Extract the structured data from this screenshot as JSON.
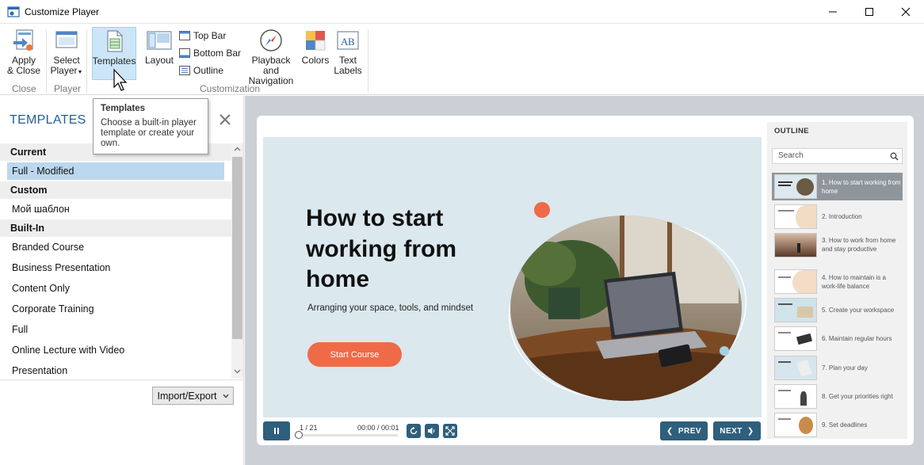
{
  "window": {
    "title": "Customize Player"
  },
  "ribbon": {
    "apply_close_line1": "Apply",
    "apply_close_line2": "& Close",
    "select_player_line1": "Select",
    "select_player_line2": "Player",
    "templates": "Templates",
    "layout": "Layout",
    "top_bar": "Top Bar",
    "bottom_bar": "Bottom Bar",
    "outline": "Outline",
    "playback_line1": "Playback and",
    "playback_line2": "Navigation",
    "colors": "Colors",
    "text_labels_line1": "Text",
    "text_labels_line2": "Labels",
    "group_close": "Close",
    "group_player": "Player",
    "group_customization": "Customization"
  },
  "tooltip": {
    "title": "Templates",
    "body": "Choose a built-in player template or create your own."
  },
  "panel": {
    "title": "TEMPLATES",
    "sections": {
      "current": "Current",
      "custom": "Custom",
      "builtin": "Built-In"
    },
    "current_items": [
      "Full - Modified"
    ],
    "custom_items": [
      "Мой шаблон"
    ],
    "builtin_items": [
      "Branded Course",
      "Business Presentation",
      "Content Only",
      "Corporate Training",
      "Full",
      "Online Lecture with Video",
      "Presentation"
    ],
    "import_export": "Import/Export"
  },
  "slide": {
    "title": "How to start working from home",
    "subtitle": "Arranging your space, tools, and mindset",
    "start_button": "Start Course",
    "accent_color": "#ef6a47",
    "bg_color": "#dbe8ee"
  },
  "controls": {
    "slide_counter": "1 / 21",
    "time": "00:00 / 00:01",
    "prev": "PREV",
    "next": "NEXT",
    "progress": 0.0
  },
  "outline": {
    "title": "OUTLINE",
    "search_placeholder": "Search",
    "items": [
      "1. How to start working from home",
      "2. Introduction",
      "3. How to work from home and stay productive",
      "4. How to maintain is a work-life balance",
      "5. Create your workspace",
      "6. Maintain regular hours",
      "7. Plan your day",
      "8. Get your priorities right",
      "9. Set deadlines"
    ]
  }
}
